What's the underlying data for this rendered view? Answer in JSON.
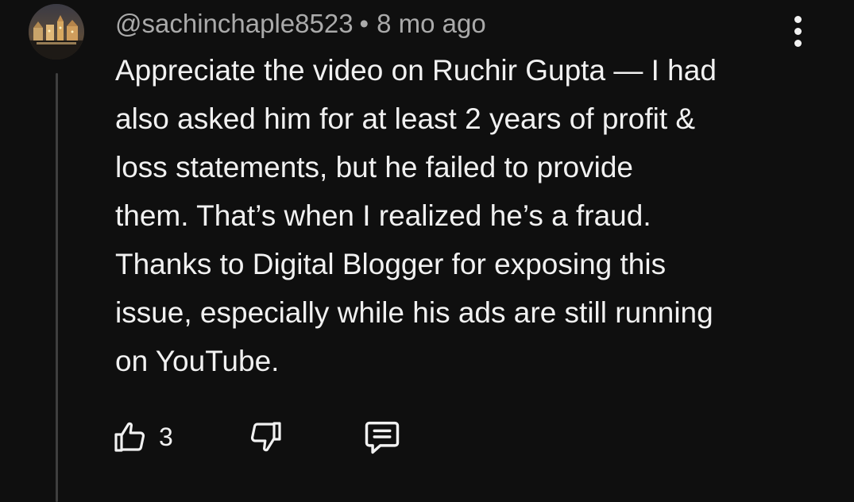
{
  "comment": {
    "author": "@sachinchaple8523",
    "separator": "•",
    "timestamp": "8 mo ago",
    "body_lines": [
      "Appreciate the video on Ruchir Gupta — I had",
      "also asked him for at least 2 years of profit &",
      "loss statements, but he failed to provide",
      "them. That’s when I realized he’s a fraud.",
      "Thanks to Digital Blogger for exposing this",
      "issue, especially while his ads are still running",
      "on YouTube."
    ],
    "like_count": "3"
  },
  "icons": {
    "menu": "more-vert-icon",
    "like": "thumb-up-outline-icon",
    "dislike": "thumb-down-outline-icon",
    "reply": "comment-reply-icon"
  },
  "colors": {
    "background": "#0f0f0f",
    "text_primary": "#f1f1f1",
    "text_secondary": "#aaaaaa",
    "thread_line": "#3f3f3f"
  }
}
